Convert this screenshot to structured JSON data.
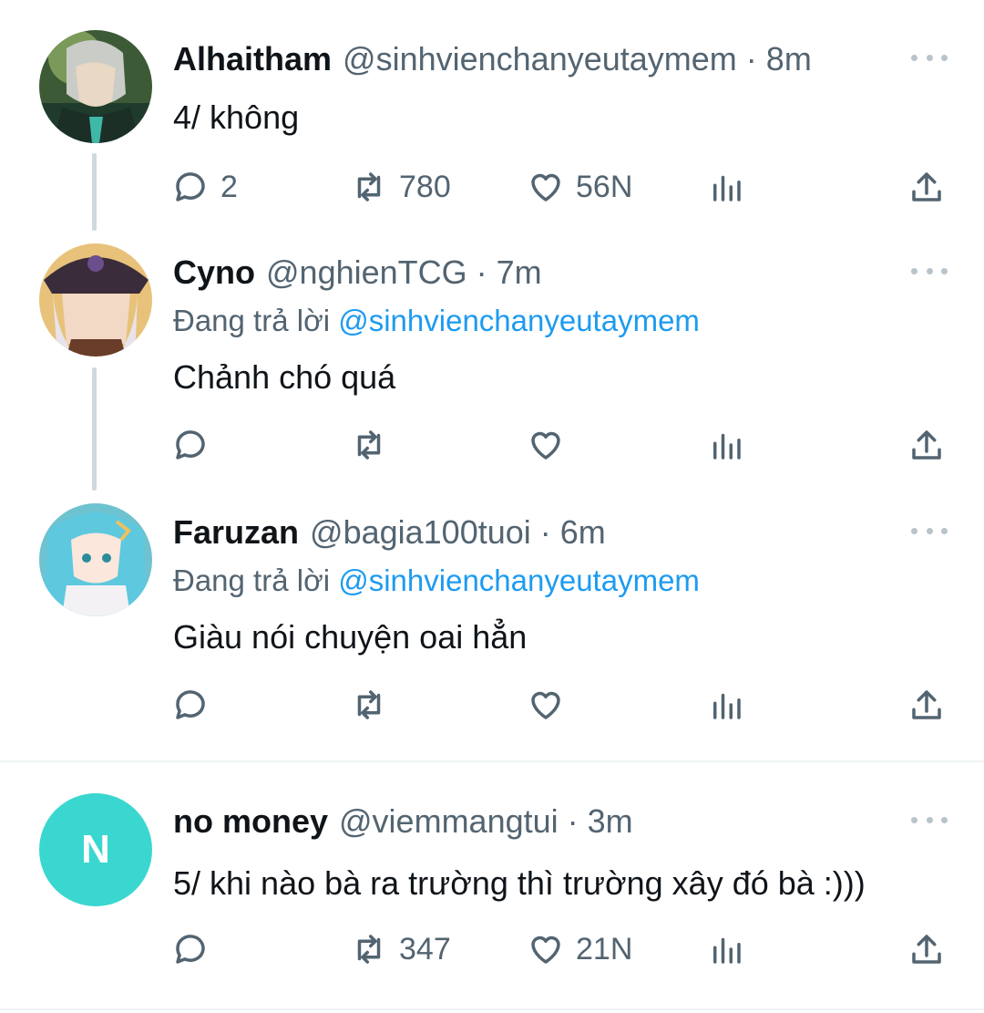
{
  "tweets": [
    {
      "name": "Alhaitham",
      "handle": "@sinhvienchanyeutaymem",
      "time": "8m",
      "text": "4/ không",
      "reply_label": "",
      "reply_mention": "",
      "replies": "2",
      "retweets": "780",
      "likes": "56N",
      "avatar_icon": "alhaitham-avatar"
    },
    {
      "name": "Cyno",
      "handle": "@nghienTCG",
      "time": "7m",
      "reply_label": "Đang trả lời",
      "reply_mention": "@sinhvienchanyeutaymem",
      "text": "Chảnh chó quá",
      "replies": "",
      "retweets": "",
      "likes": "",
      "avatar_icon": "cyno-avatar"
    },
    {
      "name": "Faruzan",
      "handle": "@bagia100tuoi",
      "time": "6m",
      "reply_label": "Đang trả lời",
      "reply_mention": "@sinhvienchanyeutaymem",
      "text": "Giàu nói chuyện oai hẳn",
      "replies": "",
      "retweets": "",
      "likes": "",
      "avatar_icon": "faruzan-avatar"
    },
    {
      "name": "no money",
      "handle": "@viemmangtui",
      "time": "3m",
      "text": "5/ khi nào bà ra trường thì trường xây đó bà :)))",
      "reply_label": "",
      "reply_mention": "",
      "replies": "",
      "retweets": "347",
      "likes": "21N",
      "avatar_letter": "N",
      "avatar_color": "#3ad7d0"
    }
  ],
  "colors": {
    "text": "#0f1419",
    "secondary": "#536471",
    "link": "#1d9bf0",
    "thread_line": "#cfd9de"
  },
  "icons": [
    "reply-icon",
    "retweet-icon",
    "like-icon",
    "views-icon",
    "share-icon",
    "more-icon"
  ]
}
